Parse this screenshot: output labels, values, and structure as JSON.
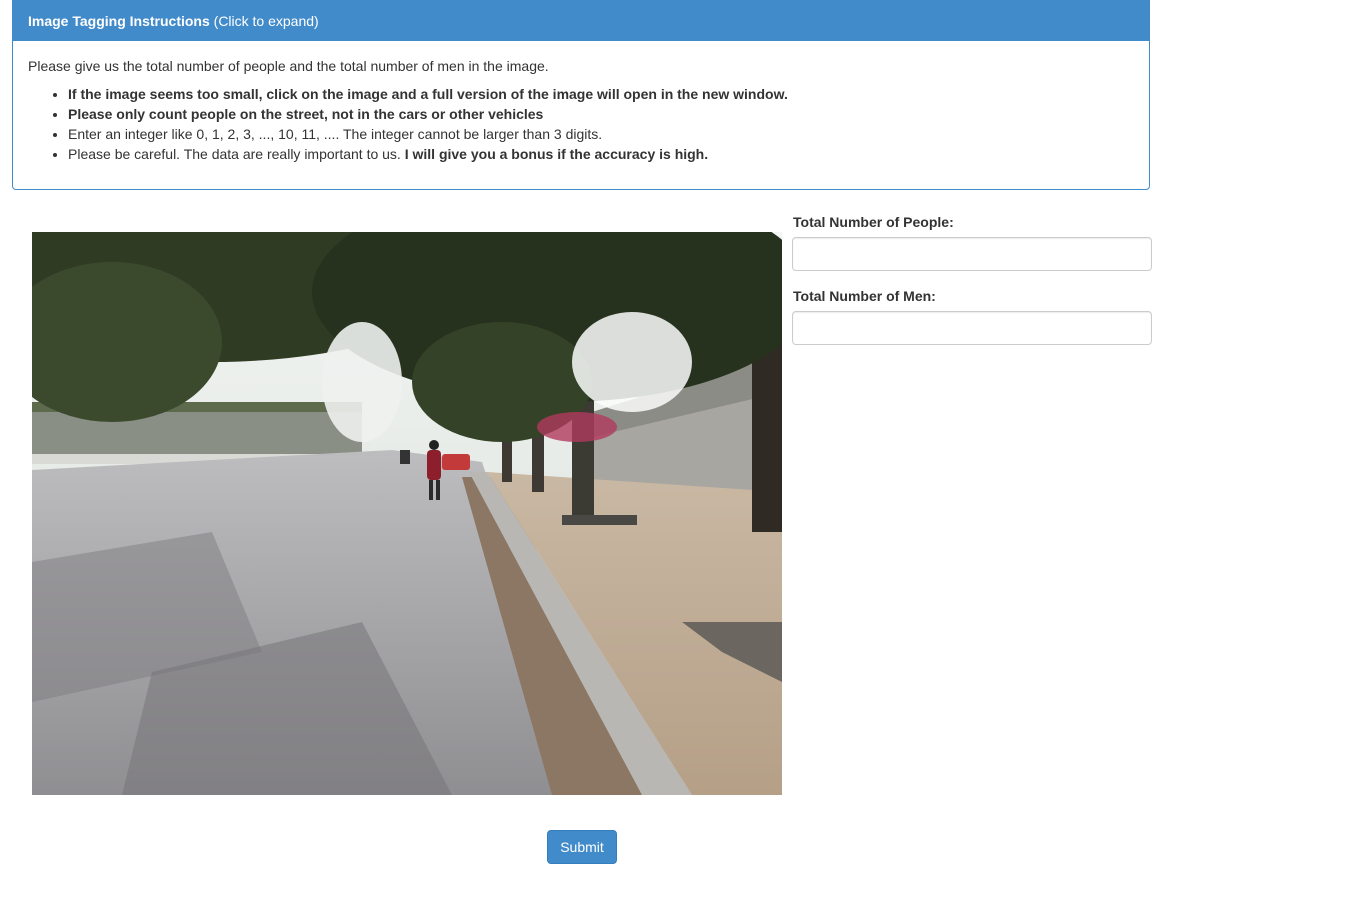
{
  "instructions": {
    "heading_bold": "Image Tagging Instructions",
    "heading_rest": " (Click to expand)",
    "intro": "Please give us the total number of people and the total number of men in the image.",
    "rules": [
      "If the image seems too small, click on the image and a full version of the image will open in the new window.",
      "Please only count people on the street, not in the cars or other vehicles",
      "Enter an integer like 0, 1, 2, 3, ..., 10, 11, .... The integer cannot be larger than 3 digits."
    ],
    "rule4_plain": "Please be careful. The data are really important to us. ",
    "rule4_bold": "I will give you a bonus if the accuracy is high."
  },
  "form": {
    "people_label": "Total Number of People:",
    "people_value": "",
    "men_label": "Total Number of Men:",
    "men_value": "",
    "submit_label": "Submit"
  },
  "colors": {
    "primary": "#428bca",
    "text": "#333333",
    "input_border": "#cccccc"
  }
}
